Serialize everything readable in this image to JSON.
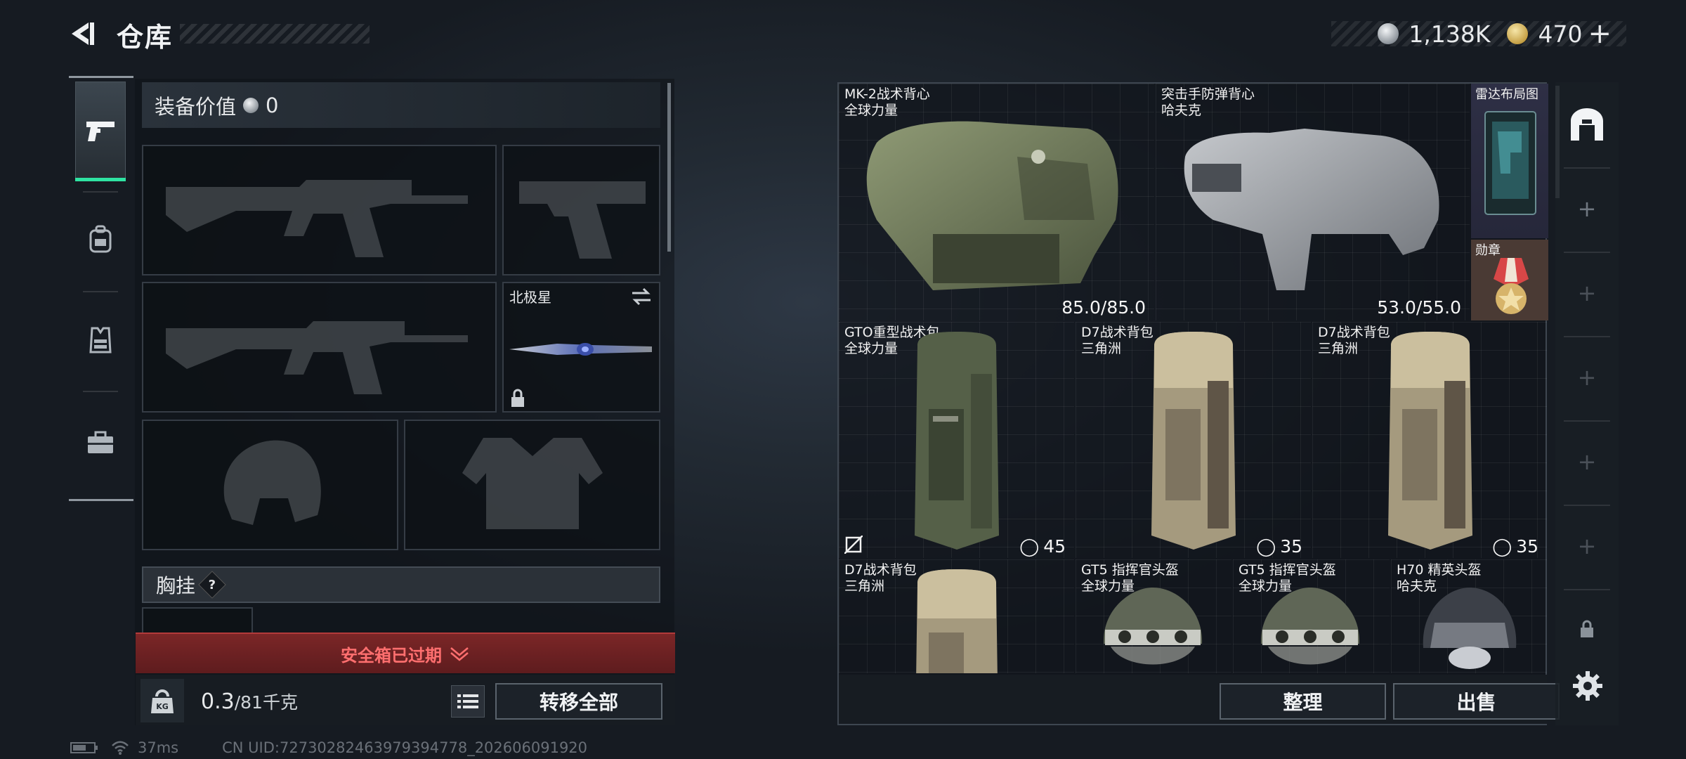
{
  "header": {
    "title": "仓库",
    "currency": [
      {
        "icon": "silver-coin-icon",
        "value": "1,138K"
      },
      {
        "icon": "gold-coin-icon",
        "value": "470"
      }
    ],
    "add_symbol": "+"
  },
  "sidebar": {
    "items": [
      {
        "name": "weapon-tab",
        "icon": "pistol-icon",
        "active": true
      },
      {
        "name": "backpack-tab",
        "icon": "backpack-icon",
        "active": false
      },
      {
        "name": "vest-tab",
        "icon": "vest-icon",
        "active": false
      },
      {
        "name": "case-tab",
        "icon": "briefcase-icon",
        "active": false
      }
    ]
  },
  "loadout": {
    "equip_value_label": "装备价值",
    "equip_value": "0",
    "melee_name": "北极星",
    "chest_label": "胸挂",
    "chest_hint": "?",
    "safe_box_expired": "安全箱已过期",
    "weight_current": "0.3",
    "weight_max": "/81千克",
    "transfer_all": "转移全部",
    "weight_icon_text": "KG"
  },
  "stash": {
    "vests": [
      {
        "line1": "MK-2战术背心",
        "line2": "全球力量",
        "durability": "85.0/85.0"
      },
      {
        "line1": "突击手防弹背心",
        "line2": "哈夫克",
        "durability": "53.0/55.0"
      }
    ],
    "radar": {
      "label": "雷达布局图"
    },
    "medal": {
      "label": "勋章"
    },
    "bags": [
      {
        "line1": "GTO重型战术包",
        "line2": "全球力量",
        "capacity": "45"
      },
      {
        "line1": "D7战术背包",
        "line2": "三角洲",
        "capacity": "35"
      },
      {
        "line1": "D7战术背包",
        "line2": "三角洲",
        "capacity": "35"
      }
    ],
    "row3": [
      {
        "line1": "D7战术背包",
        "line2": "三角洲"
      },
      {
        "line1": "GT5 指挥官头盔",
        "line2": "全球力量"
      },
      {
        "line1": "GT5 指挥官头盔",
        "line2": "全球力量"
      },
      {
        "line1": "H70 精英头盔",
        "line2": "哈夫克"
      }
    ],
    "sort_button": "整理",
    "sell_button": "出售"
  },
  "footer": {
    "ping": "37ms",
    "uid": "CN UID:7273028246397939477​8_202606091920"
  },
  "colors": {
    "accent_green": "#2fe3a2",
    "alert_red": "#ff6f6f",
    "stash_red": "#5a2028",
    "stash_purple": "#2e2f45"
  }
}
